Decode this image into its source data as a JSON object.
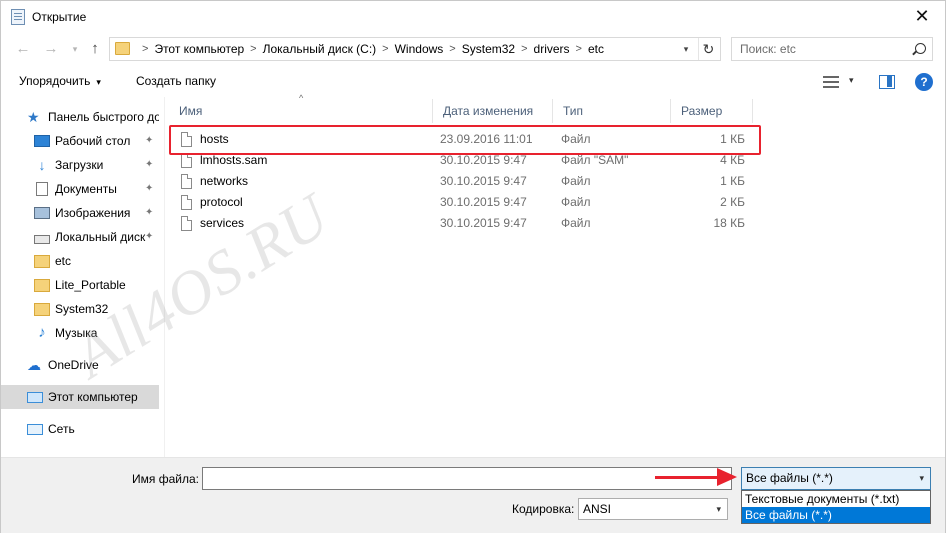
{
  "window": {
    "title": "Открытие",
    "close_glyph": "✕"
  },
  "address": {
    "crumbs": [
      "Этот компьютер",
      "Локальный диск (C:)",
      "Windows",
      "System32",
      "drivers",
      "etc"
    ],
    "separator": ">",
    "search_placeholder": "Поиск: etc"
  },
  "toolbar": {
    "organize_label": "Упорядочить",
    "new_folder_label": "Создать папку"
  },
  "sidebar": {
    "items": [
      {
        "label": "Панель быстрого доступа",
        "icon": "star-icon"
      },
      {
        "label": "Рабочий стол",
        "icon": "desktop-icon",
        "pinned": true
      },
      {
        "label": "Загрузки",
        "icon": "download-icon",
        "pinned": true
      },
      {
        "label": "Документы",
        "icon": "documents-icon",
        "pinned": true
      },
      {
        "label": "Изображения",
        "icon": "pictures-icon",
        "pinned": true
      },
      {
        "label": "Локальный диск",
        "icon": "drive-icon",
        "pinned": true
      },
      {
        "label": "etc",
        "icon": "folder-icon"
      },
      {
        "label": "Lite_Portable",
        "icon": "folder-icon"
      },
      {
        "label": "System32",
        "icon": "folder-icon"
      },
      {
        "label": "Музыка",
        "icon": "music-icon"
      },
      {
        "label": "OneDrive",
        "icon": "cloud-icon"
      },
      {
        "label": "Этот компьютер",
        "icon": "computer-icon",
        "selected": true
      },
      {
        "label": "Сеть",
        "icon": "network-icon"
      }
    ]
  },
  "filelist": {
    "columns": [
      "Имя",
      "Дата изменения",
      "Тип",
      "Размер"
    ],
    "rows": [
      {
        "name": "hosts",
        "date": "23.09.2016 11:01",
        "type": "Файл",
        "size": "1 КБ"
      },
      {
        "name": "lmhosts.sam",
        "date": "30.10.2015 9:47",
        "type": "Файл \"SAM\"",
        "size": "4 КБ"
      },
      {
        "name": "networks",
        "date": "30.10.2015 9:47",
        "type": "Файл",
        "size": "1 КБ"
      },
      {
        "name": "protocol",
        "date": "30.10.2015 9:47",
        "type": "Файл",
        "size": "2 КБ"
      },
      {
        "name": "services",
        "date": "30.10.2015 9:47",
        "type": "Файл",
        "size": "18 КБ"
      }
    ],
    "highlight_color": "#e8222e"
  },
  "watermark": "All4OS.RU",
  "bottom": {
    "filename_label": "Имя файла:",
    "filename_value": "",
    "filetype_selected": "Все файлы  (*.*)",
    "filetype_options": [
      "Текстовые документы (*.txt)",
      "Все файлы  (*.*)"
    ],
    "encoding_label": "Кодировка:",
    "encoding_value": "ANSI"
  },
  "colors": {
    "accent": "#0078d7",
    "annotation": "#e8222e"
  }
}
